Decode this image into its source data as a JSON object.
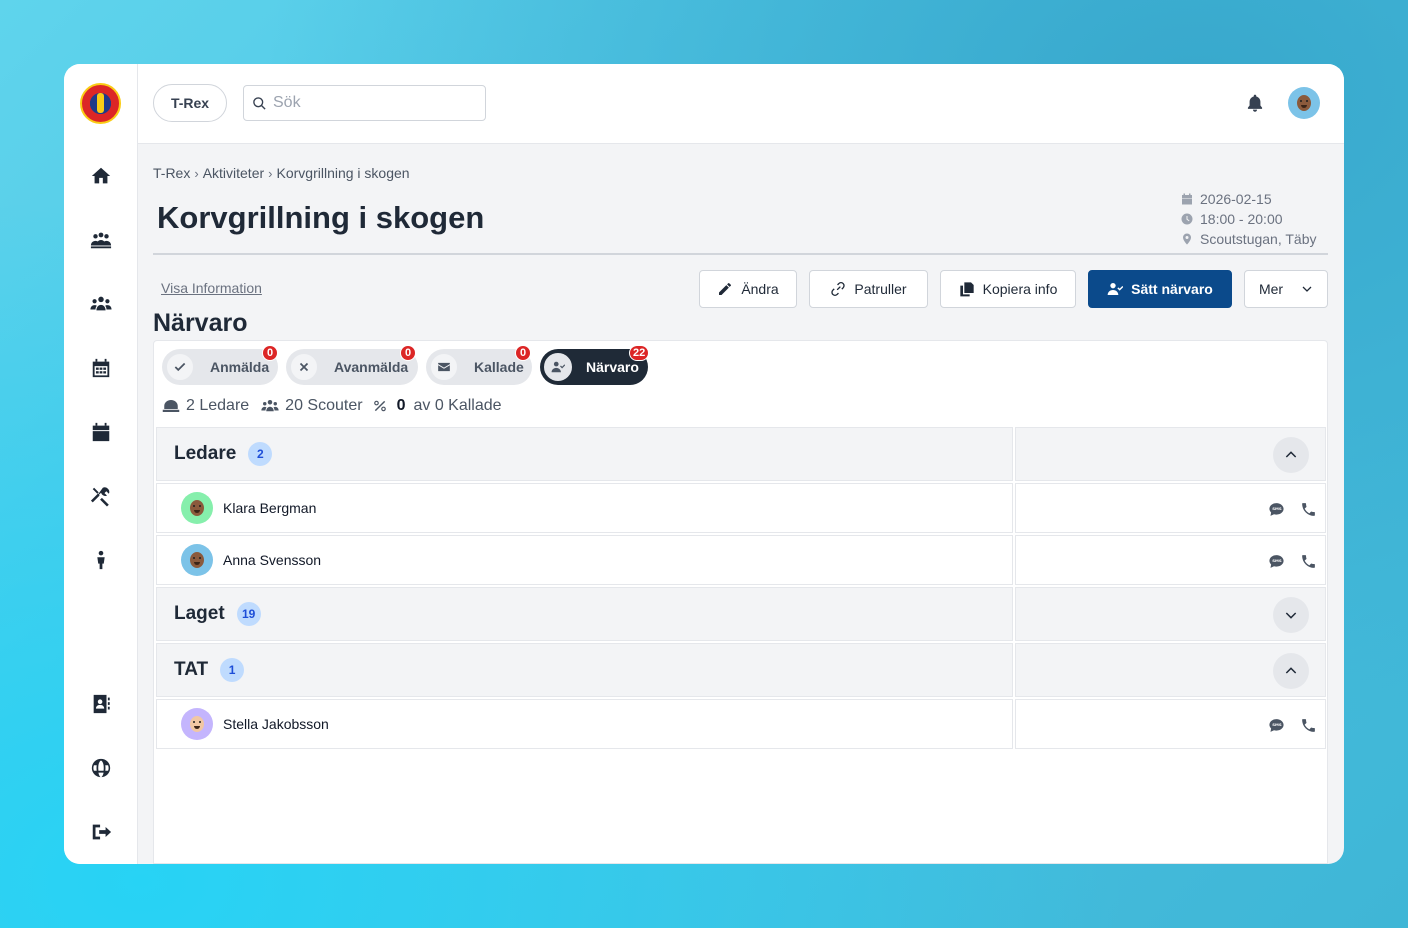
{
  "topbar": {
    "org_label": "T-Rex",
    "search_placeholder": "Sök"
  },
  "sidebar": {
    "items": [
      {
        "icon": "home-icon"
      },
      {
        "icon": "troop-icon"
      },
      {
        "icon": "groups-icon"
      },
      {
        "icon": "calendar-grid-icon"
      },
      {
        "icon": "calendar-icon"
      },
      {
        "icon": "tools-icon"
      },
      {
        "icon": "person-icon"
      },
      {
        "icon": "contacts-icon"
      },
      {
        "icon": "globe-icon"
      },
      {
        "icon": "logout-icon"
      }
    ]
  },
  "breadcrumb": [
    "T-Rex",
    "Aktiviteter",
    "Korvgrillning i skogen"
  ],
  "page": {
    "title": "Korvgrillning i skogen",
    "date": "2026-02-15",
    "time": "18:00 - 20:00",
    "location": "Scoutstugan, Täby",
    "visa_info": "Visa Information",
    "section_title": "Närvaro"
  },
  "actions": {
    "edit": "Ändra",
    "patrols": "Patruller",
    "copy": "Kopiera info",
    "attendance": "Sätt närvaro",
    "more": "Mer"
  },
  "tabs": [
    {
      "label": "Anmälda",
      "count": "0",
      "icon": "check-icon",
      "active": false
    },
    {
      "label": "Avanmälda",
      "count": "0",
      "icon": "x-icon",
      "active": false
    },
    {
      "label": "Kallade",
      "count": "0",
      "icon": "envelope-icon",
      "active": false
    },
    {
      "label": "Närvaro",
      "count": "22",
      "icon": "user-check-icon",
      "active": true
    }
  ],
  "stats": {
    "leaders": "2 Ledare",
    "scouts": "20 Scouter",
    "called_value": "0",
    "called_text": "av 0 Kallade"
  },
  "groups": [
    {
      "name": "Ledare",
      "count": "2",
      "expanded": true,
      "members": [
        {
          "name": "Klara Bergman",
          "avatar_color": "#86efac"
        },
        {
          "name": "Anna Svensson",
          "avatar_color": "#7cc3e8"
        }
      ]
    },
    {
      "name": "Laget",
      "count": "19",
      "expanded": false,
      "members": []
    },
    {
      "name": "TAT",
      "count": "1",
      "expanded": true,
      "members": [
        {
          "name": "Stella Jakobsson",
          "avatar_color": "#c4b5fd"
        }
      ]
    }
  ]
}
